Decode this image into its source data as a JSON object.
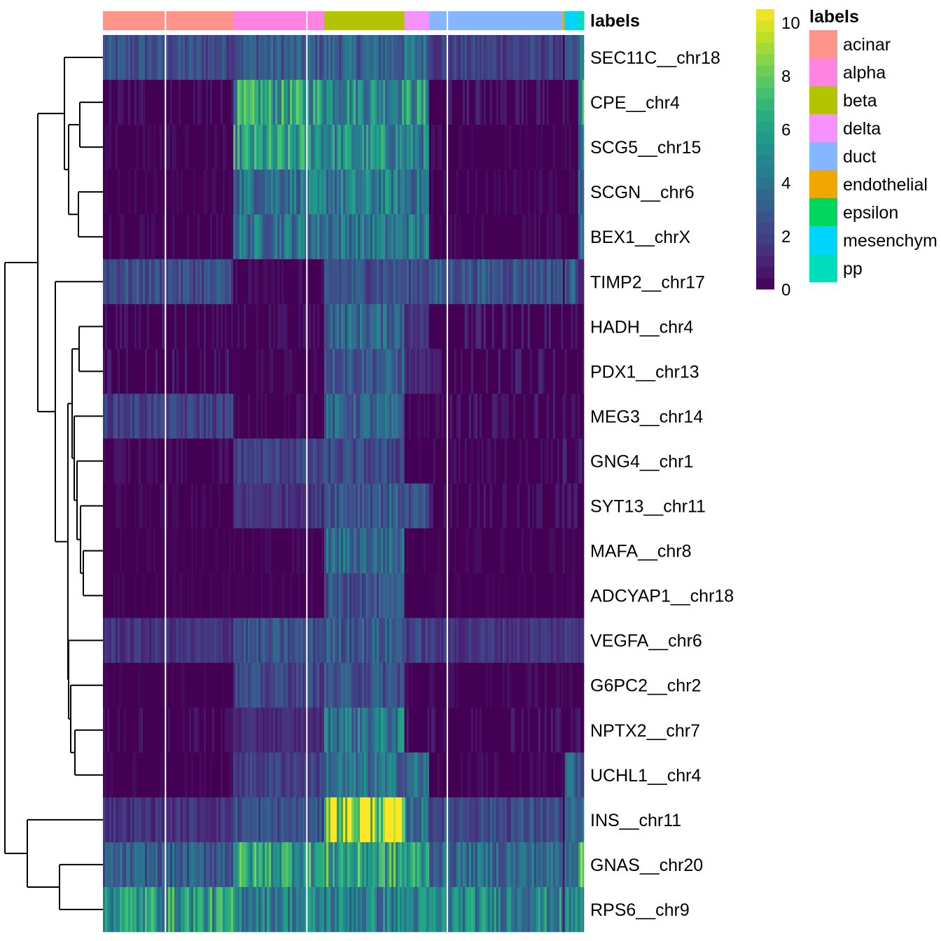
{
  "chart_data": {
    "type": "heatmap",
    "title": "",
    "value_range": [
      0,
      10.5
    ],
    "colormap": "viridis",
    "annotation": {
      "name": "labels",
      "categories": [
        {
          "label": "acinar",
          "color": "#F8766D",
          "display_color": "#FF948A",
          "fraction": 0.271
        },
        {
          "label": "alpha",
          "color": "#FF83E1",
          "fraction": 0.189
        },
        {
          "label": "beta",
          "color": "#B3C400",
          "fraction": 0.167
        },
        {
          "label": "delta",
          "color": "#F592FB",
          "fraction": 0.051
        },
        {
          "label": "duct",
          "color": "#85B6FF",
          "fraction": 0.278
        },
        {
          "label": "endothelial",
          "color": "#F0A800",
          "fraction": 0.004
        },
        {
          "label": "epsilon",
          "color": "#00D65C",
          "fraction": 0.0
        },
        {
          "label": "mesenchymal",
          "display_label": "mesenchym",
          "color": "#00D4FF",
          "fraction": 0.028
        },
        {
          "label": "pp",
          "color": "#00DDBB",
          "fraction": 0.012
        }
      ]
    },
    "column_split_fractions": [
      0.13,
      0.424,
      0.716
    ],
    "rows": [
      {
        "gene": "SEC11C__chr18",
        "means": {
          "acinar": 2.5,
          "alpha": 3.0,
          "beta": 3.3,
          "delta": 3.8,
          "duct": 2.0,
          "mesenchymal": 2.2,
          "pp": 4.0
        }
      },
      {
        "gene": "CPE__chr4",
        "means": {
          "acinar": 0.6,
          "alpha": 5.8,
          "beta": 5.2,
          "delta": 5.4,
          "duct": 0.9,
          "mesenchymal": 0.9,
          "pp": 5.5
        }
      },
      {
        "gene": "SCG5__chr15",
        "means": {
          "acinar": 0.4,
          "alpha": 5.5,
          "beta": 5.0,
          "delta": 4.5,
          "duct": 0.4,
          "mesenchymal": 0.3,
          "pp": 5.0
        }
      },
      {
        "gene": "SCGN__chr6",
        "means": {
          "acinar": 0.3,
          "alpha": 4.0,
          "beta": 4.3,
          "delta": 4.0,
          "duct": 0.4,
          "mesenchymal": 0.3,
          "pp": 4.0
        }
      },
      {
        "gene": "BEX1__chrX",
        "means": {
          "acinar": 0.4,
          "alpha": 4.0,
          "beta": 4.0,
          "delta": 4.2,
          "duct": 0.4,
          "mesenchymal": 0.3,
          "pp": 4.0
        }
      },
      {
        "gene": "TIMP2__chr17",
        "means": {
          "acinar": 2.5,
          "alpha": 0.4,
          "beta": 2.6,
          "delta": 2.6,
          "duct": 2.8,
          "mesenchymal": 3.0,
          "pp": 1.5
        }
      },
      {
        "gene": "HADH__chr4",
        "means": {
          "acinar": 0.6,
          "alpha": 0.6,
          "beta": 3.5,
          "delta": 1.5,
          "duct": 1.0,
          "mesenchymal": 0.5,
          "pp": 0.5
        }
      },
      {
        "gene": "PDX1__chr13",
        "means": {
          "acinar": 0.8,
          "alpha": 0.4,
          "beta": 3.0,
          "delta": 1.2,
          "duct": 0.9,
          "mesenchymal": 0.5,
          "pp": 0.5
        }
      },
      {
        "gene": "MEG3__chr14",
        "means": {
          "acinar": 2.0,
          "alpha": 0.5,
          "beta": 3.2,
          "delta": 0.4,
          "duct": 0.8,
          "mesenchymal": 0.5,
          "pp": 0.5
        }
      },
      {
        "gene": "GNG4__chr1",
        "means": {
          "acinar": 0.5,
          "alpha": 2.0,
          "beta": 2.2,
          "delta": 0.2,
          "duct": 0.5,
          "mesenchymal": 0.8,
          "pp": 0.8
        }
      },
      {
        "gene": "SYT13__chr11",
        "means": {
          "acinar": 0.3,
          "alpha": 1.6,
          "beta": 3.0,
          "delta": 2.5,
          "duct": 0.7,
          "mesenchymal": 0.8,
          "pp": 0.8
        }
      },
      {
        "gene": "MAFA__chr8",
        "means": {
          "acinar": 0.2,
          "alpha": 0.3,
          "beta": 3.5,
          "delta": 0.3,
          "duct": 0.3,
          "mesenchymal": 0.2,
          "pp": 0.2
        }
      },
      {
        "gene": "ADCYAP1__chr18",
        "means": {
          "acinar": 0.2,
          "alpha": 0.2,
          "beta": 2.6,
          "delta": 0.2,
          "duct": 0.2,
          "mesenchymal": 0.2,
          "pp": 0.2
        }
      },
      {
        "gene": "VEGFA__chr6",
        "means": {
          "acinar": 1.5,
          "alpha": 2.5,
          "beta": 3.0,
          "delta": 2.0,
          "duct": 1.6,
          "mesenchymal": 2.0,
          "pp": 2.0
        }
      },
      {
        "gene": "G6PC2__chr2",
        "means": {
          "acinar": 0.2,
          "alpha": 2.2,
          "beta": 2.6,
          "delta": 0.4,
          "duct": 0.4,
          "mesenchymal": 0.3,
          "pp": 0.3
        }
      },
      {
        "gene": "NPTX2__chr7",
        "means": {
          "acinar": 0.6,
          "alpha": 1.2,
          "beta": 4.2,
          "delta": 1.0,
          "duct": 0.8,
          "mesenchymal": 0.8,
          "pp": 0.8
        }
      },
      {
        "gene": "UCHL1__chr4",
        "means": {
          "acinar": 0.3,
          "alpha": 2.0,
          "beta": 3.8,
          "delta": 3.8,
          "duct": 0.4,
          "mesenchymal": 3.5,
          "pp": 3.0
        }
      },
      {
        "gene": "INS__chr11",
        "means": {
          "acinar": 1.5,
          "alpha": 2.5,
          "beta": 9.8,
          "delta": 3.8,
          "duct": 2.4,
          "mesenchymal": 3.0,
          "pp": 3.0
        }
      },
      {
        "gene": "GNAS__chr20",
        "means": {
          "acinar": 3.0,
          "alpha": 6.0,
          "beta": 6.0,
          "delta": 5.8,
          "duct": 3.6,
          "mesenchymal": 4.5,
          "pp": 6.5
        }
      },
      {
        "gene": "RPS6__chr9",
        "means": {
          "acinar": 5.6,
          "alpha": 4.6,
          "beta": 4.5,
          "delta": 4.6,
          "duct": 4.8,
          "mesenchymal": 4.8,
          "pp": 5.0
        }
      }
    ],
    "dendrogram": {
      "merges_order": "row indices 0..19 (top to bottom), hierarchical clustering of rows",
      "structure": "((((0,((1,2),(3,4))),(5,(((6,7),(8,((9,(10,(11,12))))),((13,(14,(15,16)))))))),(17,(18,19)))"
    },
    "legend_colorbar": {
      "ticks": [
        "0",
        "2",
        "4",
        "6",
        "8",
        "10"
      ],
      "tick_values": [
        0,
        2,
        4,
        6,
        8,
        10
      ],
      "max": 10.5
    },
    "legend_labels": {
      "title": "labels"
    },
    "annotation_axis_label": "labels"
  }
}
